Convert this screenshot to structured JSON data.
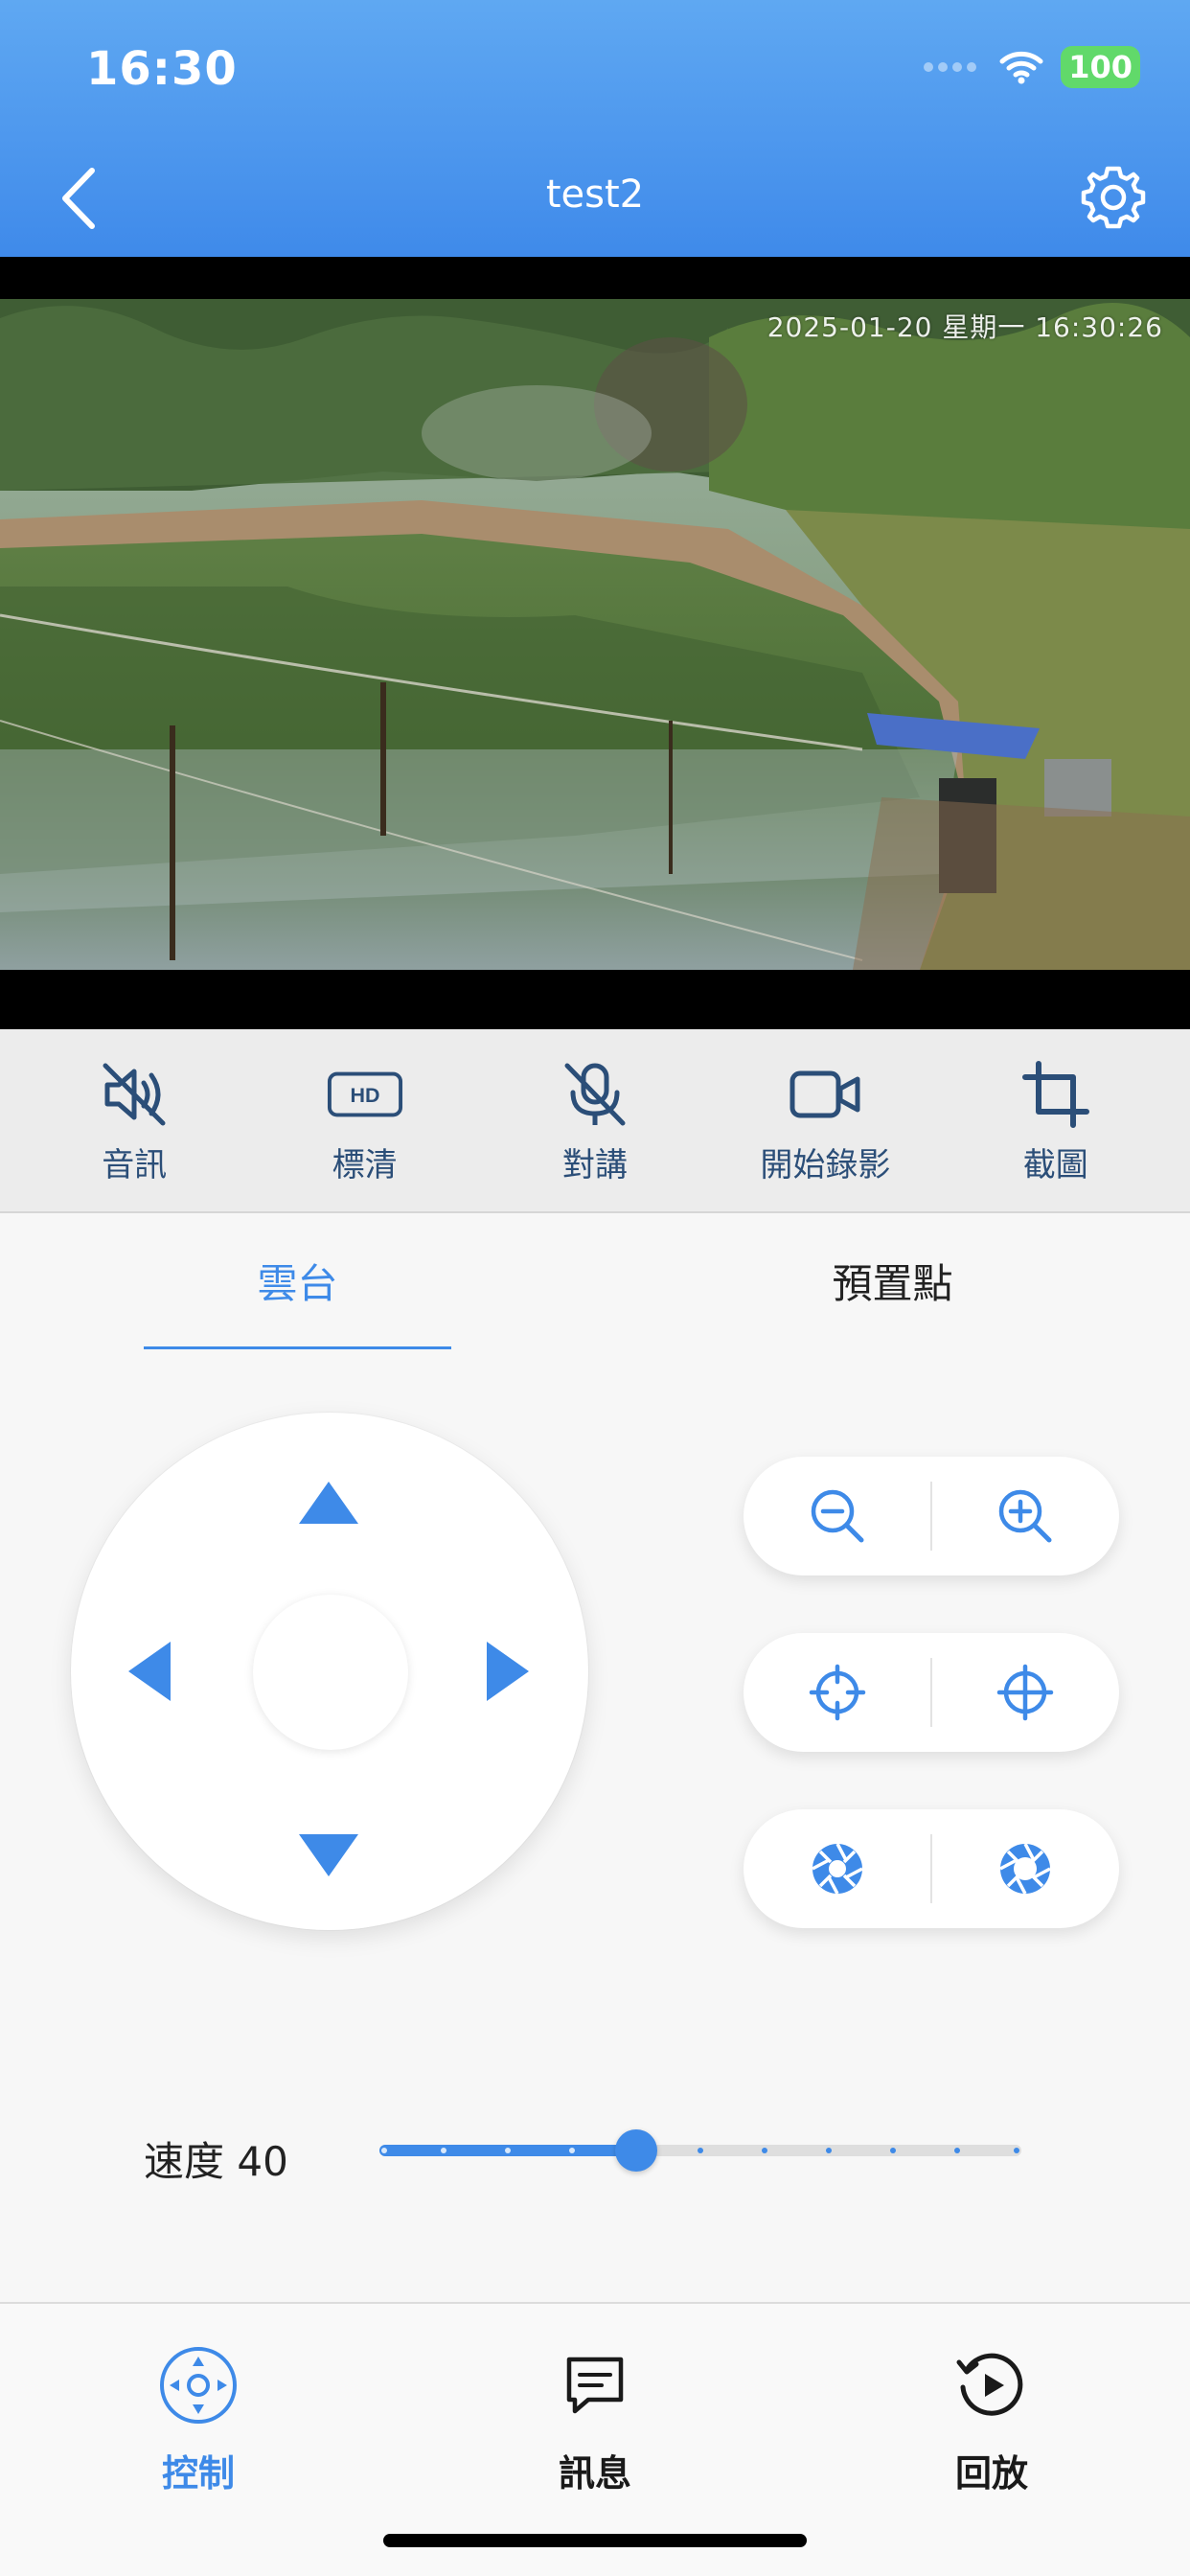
{
  "status_bar": {
    "time": "16:30",
    "battery": "100"
  },
  "header": {
    "title": "test2"
  },
  "video": {
    "timestamp": "2025-01-20 星期一 16:30:26"
  },
  "toolbar": {
    "items": [
      {
        "label": "音訊",
        "icon": "speaker-mute-icon"
      },
      {
        "label": "標清",
        "icon": "hd-icon",
        "badge": "HD"
      },
      {
        "label": "對講",
        "icon": "mic-mute-icon"
      },
      {
        "label": "開始錄影",
        "icon": "video-camera-icon"
      },
      {
        "label": "截圖",
        "icon": "crop-icon"
      }
    ]
  },
  "tabs": [
    {
      "label": "雲台",
      "active": true
    },
    {
      "label": "預置點",
      "active": false
    }
  ],
  "ptz": {
    "zoom": {
      "out_icon": "zoom-out-icon",
      "in_icon": "zoom-in-icon"
    },
    "focus": {
      "near_icon": "focus-near-icon",
      "far_icon": "focus-far-icon"
    },
    "iris": {
      "close_icon": "iris-close-icon",
      "open_icon": "iris-open-icon"
    }
  },
  "speed": {
    "label": "速度 40",
    "value": 40,
    "min": 0,
    "max": 100,
    "steps": 11
  },
  "bottom_nav": [
    {
      "label": "控制",
      "icon": "joystick-icon",
      "active": true
    },
    {
      "label": "訊息",
      "icon": "message-icon",
      "active": false
    },
    {
      "label": "回放",
      "icon": "playback-icon",
      "active": false
    }
  ],
  "colors": {
    "accent": "#3e8ae8",
    "header_top": "#5fa8f2",
    "header_bottom": "#3f8aea",
    "icon_dark": "#2b4e78"
  }
}
